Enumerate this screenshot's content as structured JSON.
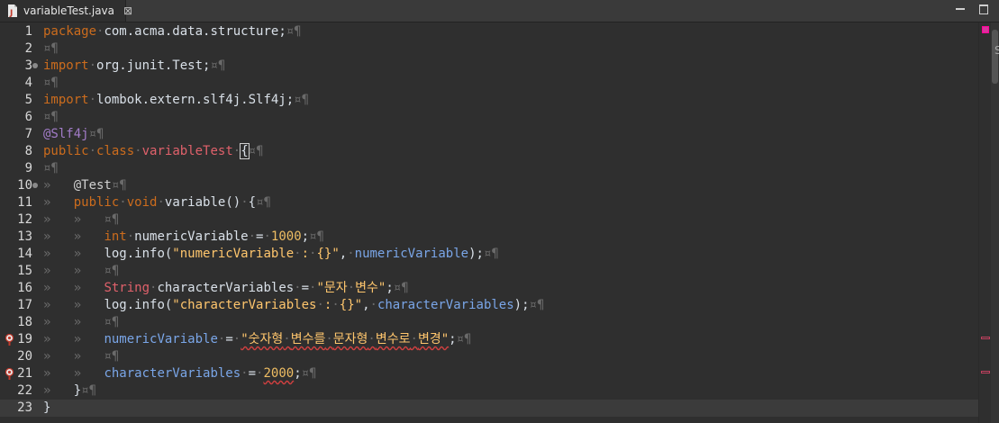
{
  "tab": {
    "title": "variableTest.java",
    "close_glyph": "⊠"
  },
  "editor": {
    "lines": [
      {
        "n": "1",
        "html": "<span class='kw'>package</span><span class='ws'>·</span>com.acma.data.structure;<span class='ws'>¤¶</span>"
      },
      {
        "n": "2",
        "html": "<span class='ws'>¤¶</span>"
      },
      {
        "n": "3",
        "html": "<span class='kw'>import</span><span class='ws'>·</span>org.junit.Test;<span class='ws'>¤¶</span>"
      },
      {
        "n": "4",
        "html": "<span class='ws'>¤¶</span>"
      },
      {
        "n": "5",
        "html": "<span class='kw'>import</span><span class='ws'>·</span>lombok.extern.slf4j.Slf4j;<span class='ws'>¤¶</span>"
      },
      {
        "n": "6",
        "html": "<span class='ws'>¤¶</span>"
      },
      {
        "n": "7",
        "html": "<span class='kw2'>@Slf4j</span><span class='ws'>¤¶</span>"
      },
      {
        "n": "8",
        "html": "<span class='kw'>public</span><span class='ws'>·</span><span class='kw'>class</span><span class='ws'>·</span><span class='cls'>variableTest</span><span class='ws'>·</span><span class='cursorbox'>{</span><span class='ws'>¤¶</span>"
      },
      {
        "n": "9",
        "html": "<span class='ws'>¤¶</span>"
      },
      {
        "n": "10",
        "html": "<span class='ws'>»   </span><span class='annot'>@Test</span><span class='ws'>¤¶</span>"
      },
      {
        "n": "11",
        "html": "<span class='ws'>»   </span><span class='kw'>public</span><span class='ws'>·</span><span class='kw'>void</span><span class='ws'>·</span>variable()<span class='ws'>·</span>{<span class='ws'>¤¶</span>"
      },
      {
        "n": "12",
        "html": "<span class='ws'>»   »   ¤¶</span>"
      },
      {
        "n": "13",
        "html": "<span class='ws'>»   »   </span><span class='kw'>int</span><span class='ws'>·</span>numericVariable<span class='ws'>·</span>=<span class='ws'>·</span><span class='str2'>1000</span>;<span class='ws'>¤¶</span>"
      },
      {
        "n": "14",
        "html": "<span class='ws'>»   »   </span>log.info(<span class='str'>\"numericVariable</span><span class='ws'>·</span><span class='str'>:</span><span class='ws'>·</span><span class='str'>{}\"</span>,<span class='ws'>·</span><span class='field'>numericVariable</span>);<span class='ws'>¤¶</span>"
      },
      {
        "n": "15",
        "html": "<span class='ws'>»   »   ¤¶</span>"
      },
      {
        "n": "16",
        "html": "<span class='ws'>»   »   </span><span class='cls'>String</span><span class='ws'>·</span>characterVariables<span class='ws'>·</span>=<span class='ws'>·</span><span class='str'>\"문자</span><span class='ws'>·</span><span class='str'>변수\"</span>;<span class='ws'>¤¶</span>"
      },
      {
        "n": "17",
        "html": "<span class='ws'>»   »   </span>log.info(<span class='str'>\"characterVariables</span><span class='ws'>·</span><span class='str'>:</span><span class='ws'>·</span><span class='str'>{}\"</span>,<span class='ws'>·</span><span class='field'>characterVariables</span>);<span class='ws'>¤¶</span>"
      },
      {
        "n": "18",
        "html": "<span class='ws'>»   »   ¤¶</span>"
      },
      {
        "n": "19",
        "html": "<span class='ws'>»   »   </span><span class='field'>numericVariable</span><span class='ws'>·</span>=<span class='ws'>·</span><span class='str err'>\"숫자형</span><span class='ws err'>·</span><span class='str err'>변수를</span><span class='ws err'>·</span><span class='str err'>문자형</span><span class='ws err'>·</span><span class='str err'>변수로</span><span class='ws err'>·</span><span class='str err'>변경\"</span>;<span class='ws'>¤¶</span>"
      },
      {
        "n": "20",
        "html": "<span class='ws'>»   »   ¤¶</span>"
      },
      {
        "n": "21",
        "html": "<span class='ws'>»   »   </span><span class='field'>characterVariables</span><span class='ws'>·</span>=<span class='ws'>·</span><span class='str2 err'>2000</span>;<span class='ws'>¤¶</span>"
      },
      {
        "n": "22",
        "html": "<span class='ws'>»   </span>}<span class='ws'>¤¶</span>"
      },
      {
        "n": "23",
        "html": "}"
      }
    ],
    "fold_lines": [
      "3",
      "10"
    ],
    "error_lines": [
      "19",
      "21"
    ],
    "current_line": "23"
  },
  "ruler": {
    "side_letter": "S"
  },
  "colors": {
    "background": "#2f2f2f",
    "keyword": "#cc6c1d",
    "string": "#ffc66d",
    "error": "#d04040"
  },
  "icons": {
    "file": "java-file-icon",
    "error": "error-marker-icon"
  }
}
